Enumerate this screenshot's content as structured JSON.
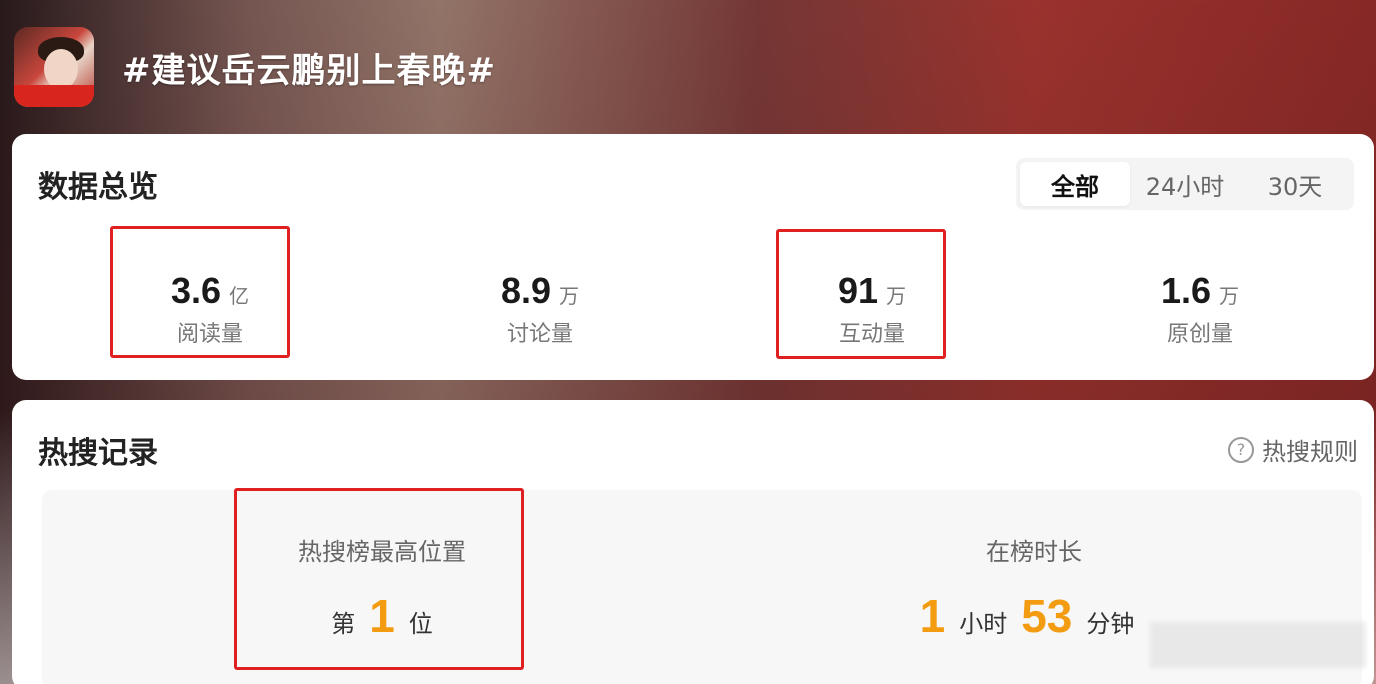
{
  "header": {
    "topic_title": "#建议岳云鹏别上春晚#"
  },
  "overview": {
    "title": "数据总览",
    "tabs": [
      {
        "label": "全部",
        "active": true
      },
      {
        "label": "24小时",
        "active": false
      },
      {
        "label": "30天",
        "active": false
      }
    ],
    "stats": [
      {
        "value": "3.6",
        "unit": "亿",
        "label": "阅读量",
        "highlighted": true
      },
      {
        "value": "8.9",
        "unit": "万",
        "label": "讨论量",
        "highlighted": false
      },
      {
        "value": "91",
        "unit": "万",
        "label": "互动量",
        "highlighted": true
      },
      {
        "value": "1.6",
        "unit": "万",
        "label": "原创量",
        "highlighted": false
      }
    ]
  },
  "hot_search": {
    "title": "热搜记录",
    "rules_link": "热搜规则",
    "rules_icon": "question-circle-icon",
    "best_rank": {
      "label": "热搜榜最高位置",
      "prefix": "第",
      "value": "1",
      "suffix": "位"
    },
    "duration": {
      "label": "在榜时长",
      "hours": "1",
      "hours_unit": "小时",
      "minutes": "53",
      "minutes_unit": "分钟"
    }
  },
  "colors": {
    "highlight_box": "#e02020",
    "accent_number": "#f39c12"
  }
}
